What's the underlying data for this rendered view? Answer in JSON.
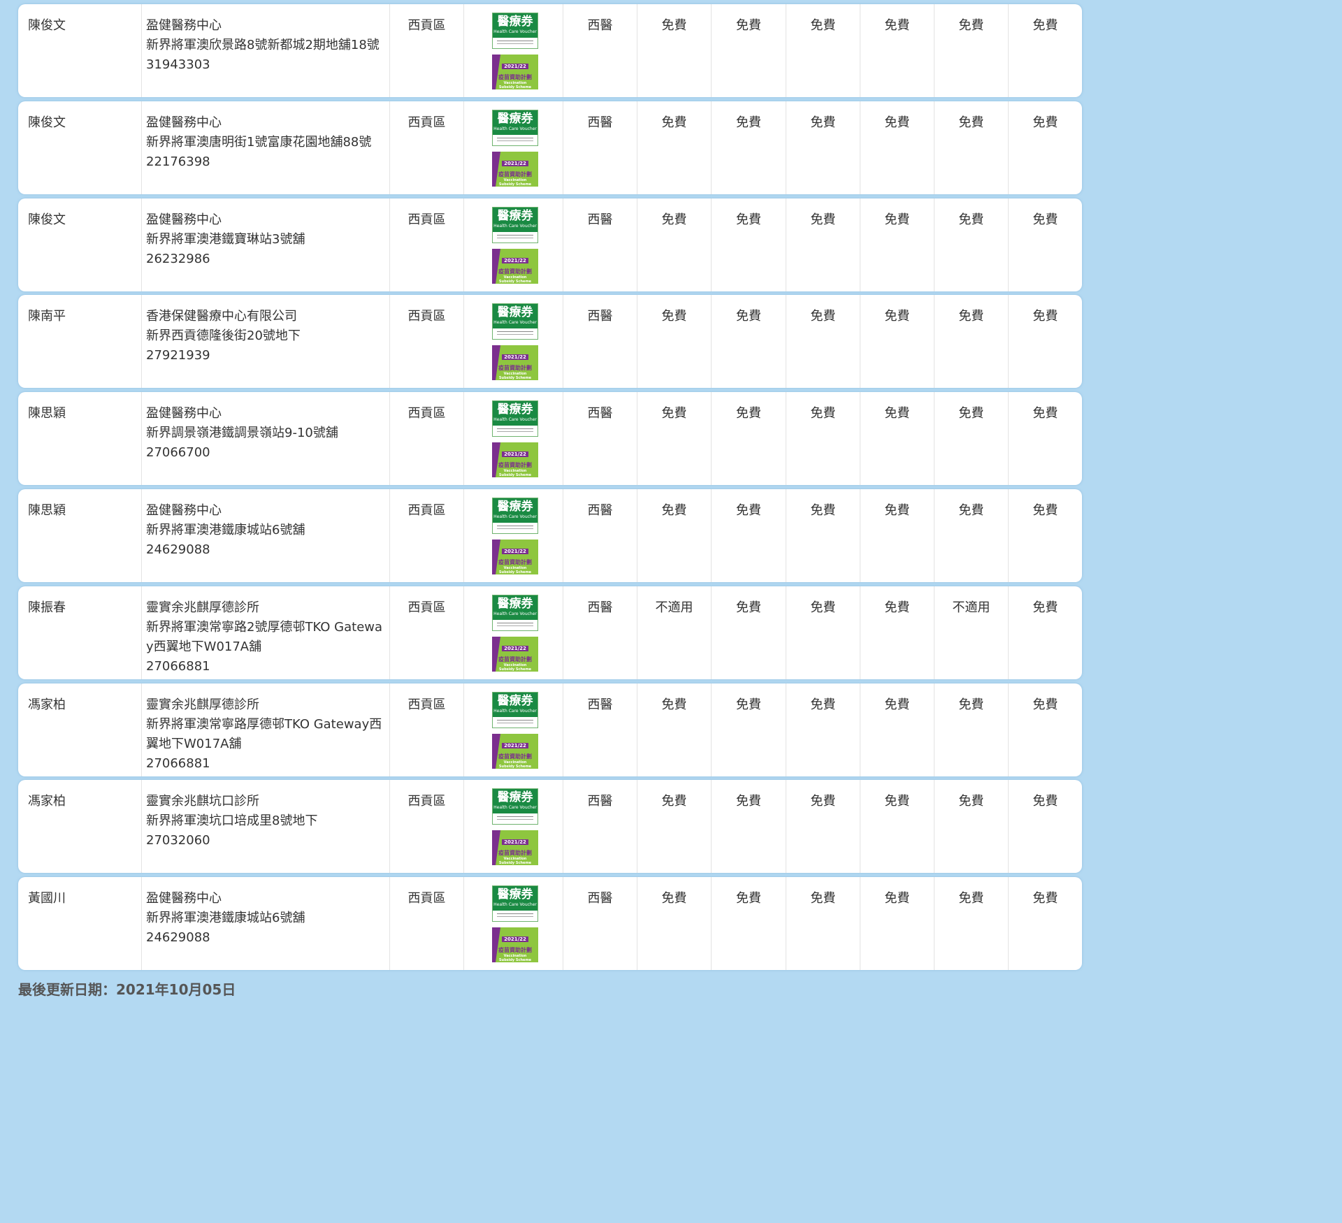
{
  "badges": {
    "hcv_zh": "醫療券",
    "hcv_en": "Health Care Voucher",
    "vss_year": "2021/22",
    "vss_zh": "疫苗資助計劃",
    "vss_en1": "Vaccination",
    "vss_en2": "Subsidy Scheme"
  },
  "rows": [
    {
      "name": "陳俊文",
      "clinic": "盈健醫務中心",
      "address": "新界將軍澳欣景路8號新都城2期地舖18號",
      "phone": "31943303",
      "district": "西貢區",
      "type": "西醫",
      "s": [
        "免費",
        "免費",
        "免費",
        "免費",
        "免費",
        "免費"
      ]
    },
    {
      "name": "陳俊文",
      "clinic": "盈健醫務中心",
      "address": "新界將軍澳唐明街1號富康花園地舖88號",
      "phone": "22176398",
      "district": "西貢區",
      "type": "西醫",
      "s": [
        "免費",
        "免費",
        "免費",
        "免費",
        "免費",
        "免費"
      ]
    },
    {
      "name": "陳俊文",
      "clinic": "盈健醫務中心",
      "address": "新界將軍澳港鐵寶琳站3號舖",
      "phone": "26232986",
      "district": "西貢區",
      "type": "西醫",
      "s": [
        "免費",
        "免費",
        "免費",
        "免費",
        "免費",
        "免費"
      ]
    },
    {
      "name": "陳南平",
      "clinic": "香港保健醫療中心有限公司",
      "address": "新界西貢德隆後街20號地下",
      "phone": "27921939",
      "district": "西貢區",
      "type": "西醫",
      "s": [
        "免費",
        "免費",
        "免費",
        "免費",
        "免費",
        "免費"
      ]
    },
    {
      "name": "陳思穎",
      "clinic": "盈健醫務中心",
      "address": "新界調景嶺港鐵調景嶺站9-10號舖",
      "phone": "27066700",
      "district": "西貢區",
      "type": "西醫",
      "s": [
        "免費",
        "免費",
        "免費",
        "免費",
        "免費",
        "免費"
      ]
    },
    {
      "name": "陳思穎",
      "clinic": "盈健醫務中心",
      "address": "新界將軍澳港鐵康城站6號舖",
      "phone": "24629088",
      "district": "西貢區",
      "type": "西醫",
      "s": [
        "免費",
        "免費",
        "免費",
        "免費",
        "免費",
        "免費"
      ]
    },
    {
      "name": "陳振春",
      "clinic": "靈實余兆麒厚德診所",
      "address": "新界將軍澳常寧路2號厚德邨TKO Gateway西翼地下W017A舖",
      "phone": "27066881",
      "district": "西貢區",
      "type": "西醫",
      "s": [
        "不適用",
        "免費",
        "免費",
        "免費",
        "不適用",
        "免費"
      ]
    },
    {
      "name": "馮家柏",
      "clinic": "靈實余兆麒厚德診所",
      "address": "新界將軍澳常寧路厚德邨TKO Gateway西翼地下W017A舖",
      "phone": "27066881",
      "district": "西貢區",
      "type": "西醫",
      "s": [
        "免費",
        "免費",
        "免費",
        "免費",
        "免費",
        "免費"
      ]
    },
    {
      "name": "馮家柏",
      "clinic": "靈實余兆麒坑口診所",
      "address": "新界將軍澳坑口培成里8號地下",
      "phone": "27032060",
      "district": "西貢區",
      "type": "西醫",
      "s": [
        "免費",
        "免費",
        "免費",
        "免費",
        "免費",
        "免費"
      ]
    },
    {
      "name": "黃國川",
      "clinic": "盈健醫務中心",
      "address": "新界將軍澳港鐵康城站6號舖",
      "phone": "24629088",
      "district": "西貢區",
      "type": "西醫",
      "s": [
        "免費",
        "免費",
        "免費",
        "免費",
        "免費",
        "免費"
      ]
    }
  ],
  "footer": "最後更新日期：2021年10月05日"
}
